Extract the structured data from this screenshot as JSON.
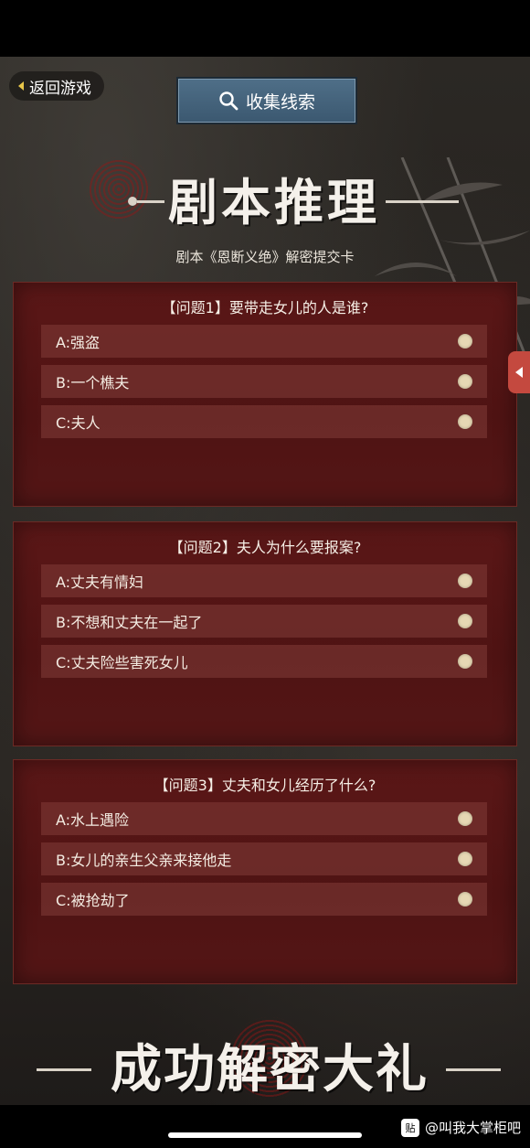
{
  "header": {
    "back_label": "返回游戏",
    "clue_label": "收集线索",
    "title": "剧本推理",
    "subtitle": "剧本《恩断义绝》解密提交卡"
  },
  "questions": [
    {
      "title": "【问题1】要带走女儿的人是谁?",
      "options": [
        "A:强盗",
        "B:一个樵夫",
        "C:夫人"
      ]
    },
    {
      "title": "【问题2】夫人为什么要报案?",
      "options": [
        "A:丈夫有情妇",
        "B:不想和丈夫在一起了",
        "C:丈夫险些害死女儿"
      ]
    },
    {
      "title": "【问题3】丈夫和女儿经历了什么?",
      "options": [
        "A:水上遇险",
        "B:女儿的亲生父亲来接他走",
        "C:被抢劫了"
      ]
    }
  ],
  "footer": {
    "reward_title": "成功解密大礼",
    "source_label": "@叫我大掌柜吧",
    "badge_text": "贴"
  },
  "colors": {
    "card": "#541616",
    "clue_button": "#4a6a83",
    "side_tab": "#c4493f",
    "radio": "#e6d8b4"
  }
}
